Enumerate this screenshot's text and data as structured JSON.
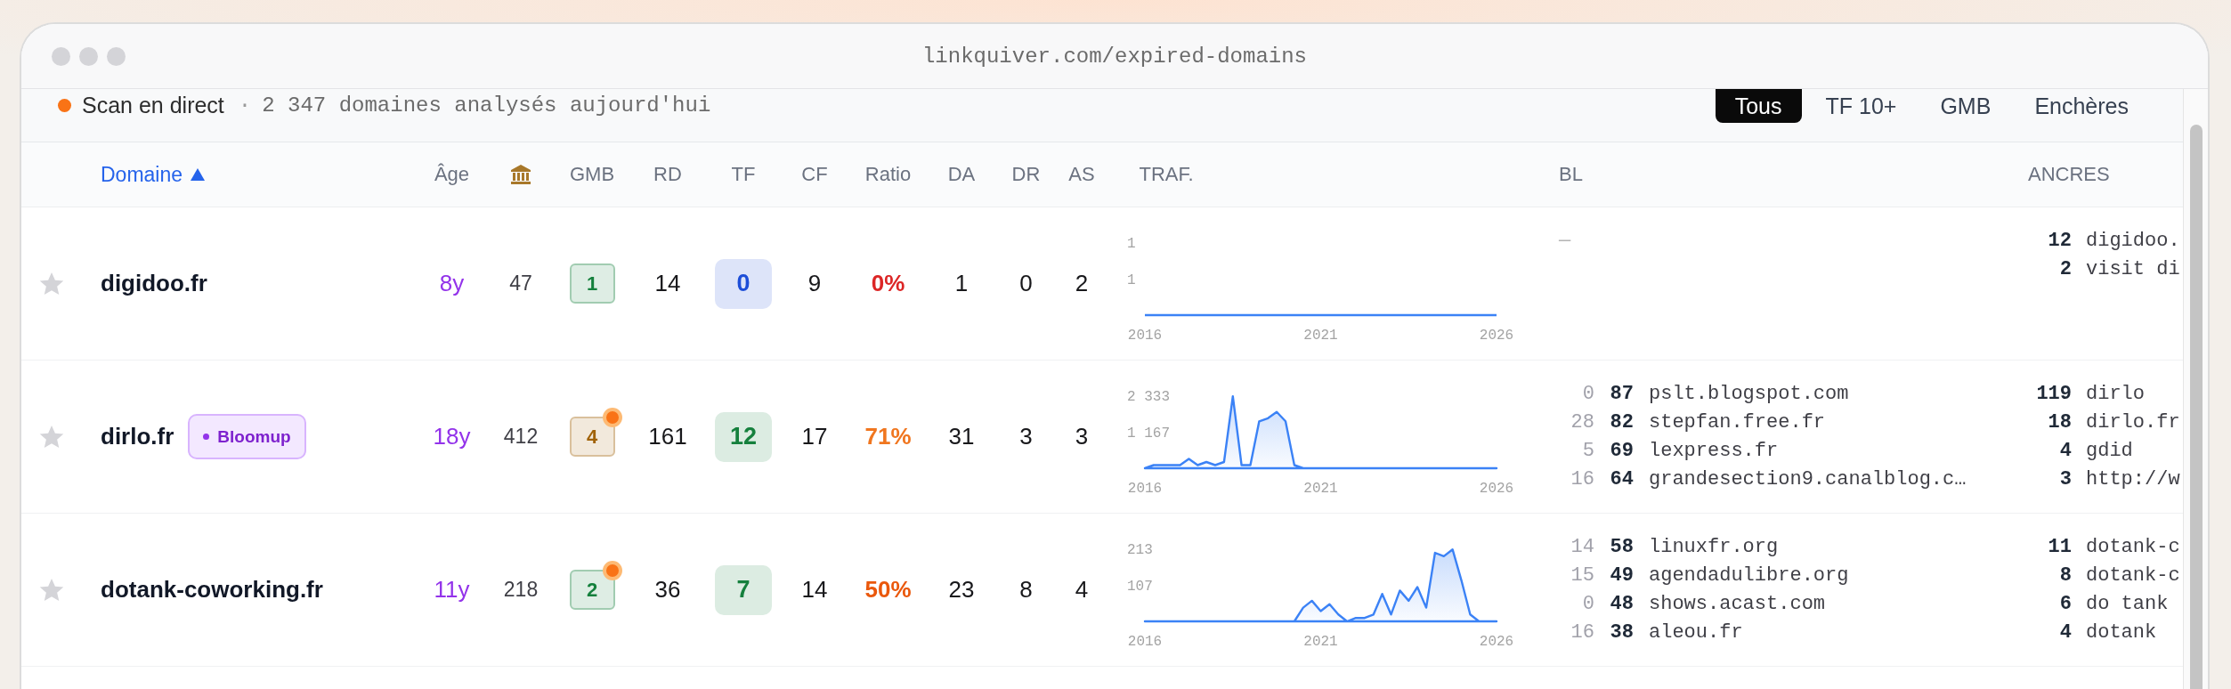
{
  "window": {
    "url": "linkquiver.com/expired-domains"
  },
  "live": {
    "label": "Scan en direct",
    "separator": "·",
    "summary": "2 347 domaines analysés aujourd'hui"
  },
  "filters": [
    {
      "label": "Tous",
      "selected": true
    },
    {
      "label": "TF 10+",
      "selected": false
    },
    {
      "label": "GMB",
      "selected": false
    },
    {
      "label": "Enchères",
      "selected": false
    }
  ],
  "columns": [
    {
      "kind": "text",
      "label": "Domaine",
      "sorted": true
    },
    {
      "kind": "text",
      "label": "Âge",
      "sorted": false
    },
    {
      "kind": "icon"
    },
    {
      "kind": "text",
      "label": "GMB",
      "sorted": false
    },
    {
      "kind": "text",
      "label": "RD",
      "sorted": false
    },
    {
      "kind": "text",
      "label": "TF",
      "sorted": false
    },
    {
      "kind": "text",
      "label": "CF",
      "sorted": false
    },
    {
      "kind": "text",
      "label": "Ratio",
      "sorted": false
    },
    {
      "kind": "text",
      "label": "DA",
      "sorted": false
    },
    {
      "kind": "text",
      "label": "DR",
      "sorted": false
    },
    {
      "kind": "text",
      "label": "AS",
      "sorted": false
    },
    {
      "kind": "text",
      "label": "TRAF.",
      "sorted": false
    },
    {
      "kind": "text",
      "label": "BL",
      "sorted": false
    },
    {
      "kind": "text",
      "label": "ANCRES",
      "sorted": false
    }
  ],
  "rows": [
    {
      "starred": false,
      "domain": "digidoo.fr",
      "age": "8y",
      "bank": "47",
      "gmb": {
        "text": "1",
        "color": "#15803d",
        "alert": false
      },
      "rd": "14",
      "tf": {
        "text": "0",
        "color": "#1d4ed8"
      },
      "cf": "9",
      "ratio": {
        "text": "0%",
        "color": "#dc2626"
      },
      "da": "1",
      "dr": "0",
      "as": "2",
      "traffic": {
        "y_labels": [
          "1",
          "1"
        ],
        "x_labels": [
          "2016",
          "2021",
          "2026"
        ]
      },
      "bl_placeholder": "—",
      "anchors": [
        {
          "count": "12",
          "text": "digidoo."
        },
        {
          "count": "2",
          "text": "visit di"
        }
      ]
    },
    {
      "starred": false,
      "domain": "dirlo.fr",
      "tag": "Bloomup",
      "age": "18y",
      "bank": "412",
      "gmb": {
        "text": "4",
        "color": "#a16207",
        "alert": true
      },
      "rd": "161",
      "tf": {
        "text": "12",
        "color": "#15803d"
      },
      "cf": "17",
      "ratio": {
        "text": "71%",
        "color": "#f0761f"
      },
      "da": "31",
      "dr": "3",
      "as": "3",
      "traffic": {
        "chart_data": {
          "type": "area",
          "x": [
            2016,
            2016.25,
            2016.5,
            2016.75,
            2017,
            2017.25,
            2017.5,
            2017.75,
            2018,
            2018.25,
            2018.5,
            2018.75,
            2019,
            2019.25,
            2019.5,
            2019.75,
            2020,
            2020.25,
            2020.5,
            2020.75,
            2021,
            2021.25,
            2021.5,
            2021.75,
            2022,
            2022.25,
            2022.5,
            2022.75,
            2023,
            2023.25,
            2023.5,
            2023.75,
            2024,
            2024.25,
            2024.5,
            2024.75,
            2025,
            2025.25,
            2025.5,
            2025.75,
            2026
          ],
          "series": [
            {
              "color": "#3b82f6",
              "values": [
                0,
                100,
                100,
                100,
                100,
                300,
                100,
                200,
                100,
                200,
                2300,
                100,
                100,
                1500,
                1600,
                1800,
                1500,
                100,
                0,
                0,
                0,
                0,
                0,
                0,
                0,
                0,
                0,
                0,
                0,
                0,
                0,
                0,
                0,
                0,
                0,
                0,
                0,
                0,
                0,
                0,
                0
              ]
            }
          ],
          "xlim": [
            2016,
            2026
          ],
          "ylim": [
            0,
            2333
          ],
          "xticks": [
            2016,
            2021,
            2026
          ],
          "yticks": [
            {
              "value": 1167,
              "label": "1 167"
            },
            {
              "value": 2333,
              "label": "2 333"
            }
          ]
        }
      },
      "bl": [
        {
          "count": "0",
          "score": "87",
          "domain": "pslt.blogspot.com"
        },
        {
          "count": "28",
          "score": "82",
          "domain": "stepfan.free.fr"
        },
        {
          "count": "5",
          "score": "69",
          "domain": "lexpress.fr"
        },
        {
          "count": "16",
          "score": "64",
          "domain": "grandesection9.canalblog.c…"
        }
      ],
      "anchors": [
        {
          "count": "119",
          "text": "dirlo"
        },
        {
          "count": "18",
          "text": "dirlo.fr"
        },
        {
          "count": "4",
          "text": "gdid"
        },
        {
          "count": "3",
          "text": "http://w"
        }
      ]
    },
    {
      "starred": false,
      "domain": "dotank-coworking.fr",
      "age": "11y",
      "bank": "218",
      "gmb": {
        "text": "2",
        "color": "#15803d",
        "alert": true
      },
      "rd": "36",
      "tf": {
        "text": "7",
        "color": "#15803d"
      },
      "cf": "14",
      "ratio": {
        "text": "50%",
        "color": "#ea580c"
      },
      "da": "23",
      "dr": "8",
      "as": "4",
      "traffic": {
        "chart_data": {
          "type": "area",
          "x": [
            2016,
            2016.25,
            2016.5,
            2016.75,
            2017,
            2017.25,
            2017.5,
            2017.75,
            2018,
            2018.25,
            2018.5,
            2018.75,
            2019,
            2019.25,
            2019.5,
            2019.75,
            2020,
            2020.25,
            2020.5,
            2020.75,
            2021,
            2021.25,
            2021.5,
            2021.75,
            2022,
            2022.25,
            2022.5,
            2022.75,
            2023,
            2023.25,
            2023.5,
            2023.75,
            2024,
            2024.25,
            2024.5,
            2024.75,
            2025,
            2025.25,
            2025.5,
            2025.75,
            2026
          ],
          "series": [
            {
              "color": "#3b82f6",
              "values": [
                0,
                0,
                0,
                0,
                0,
                0,
                0,
                0,
                0,
                0,
                0,
                0,
                0,
                0,
                0,
                0,
                0,
                0,
                40,
                60,
                30,
                50,
                20,
                0,
                10,
                10,
                20,
                80,
                20,
                90,
                60,
                100,
                40,
                200,
                190,
                210,
                120,
                20,
                0,
                0,
                0
              ]
            }
          ],
          "xlim": [
            2016,
            2026
          ],
          "ylim": [
            0,
            213
          ],
          "xticks": [
            2016,
            2021,
            2026
          ],
          "yticks": [
            {
              "value": 107,
              "label": "107"
            },
            {
              "value": 213,
              "label": "213"
            }
          ]
        }
      },
      "bl": [
        {
          "count": "14",
          "score": "58",
          "domain": "linuxfr.org"
        },
        {
          "count": "15",
          "score": "49",
          "domain": "agendadulibre.org"
        },
        {
          "count": "0",
          "score": "48",
          "domain": "shows.acast.com"
        },
        {
          "count": "16",
          "score": "38",
          "domain": "aleou.fr"
        }
      ],
      "anchors": [
        {
          "count": "11",
          "text": "dotank-c"
        },
        {
          "count": "8",
          "text": "dotank-c"
        },
        {
          "count": "6",
          "text": "do tank"
        },
        {
          "count": "4",
          "text": "dotank"
        }
      ]
    }
  ]
}
